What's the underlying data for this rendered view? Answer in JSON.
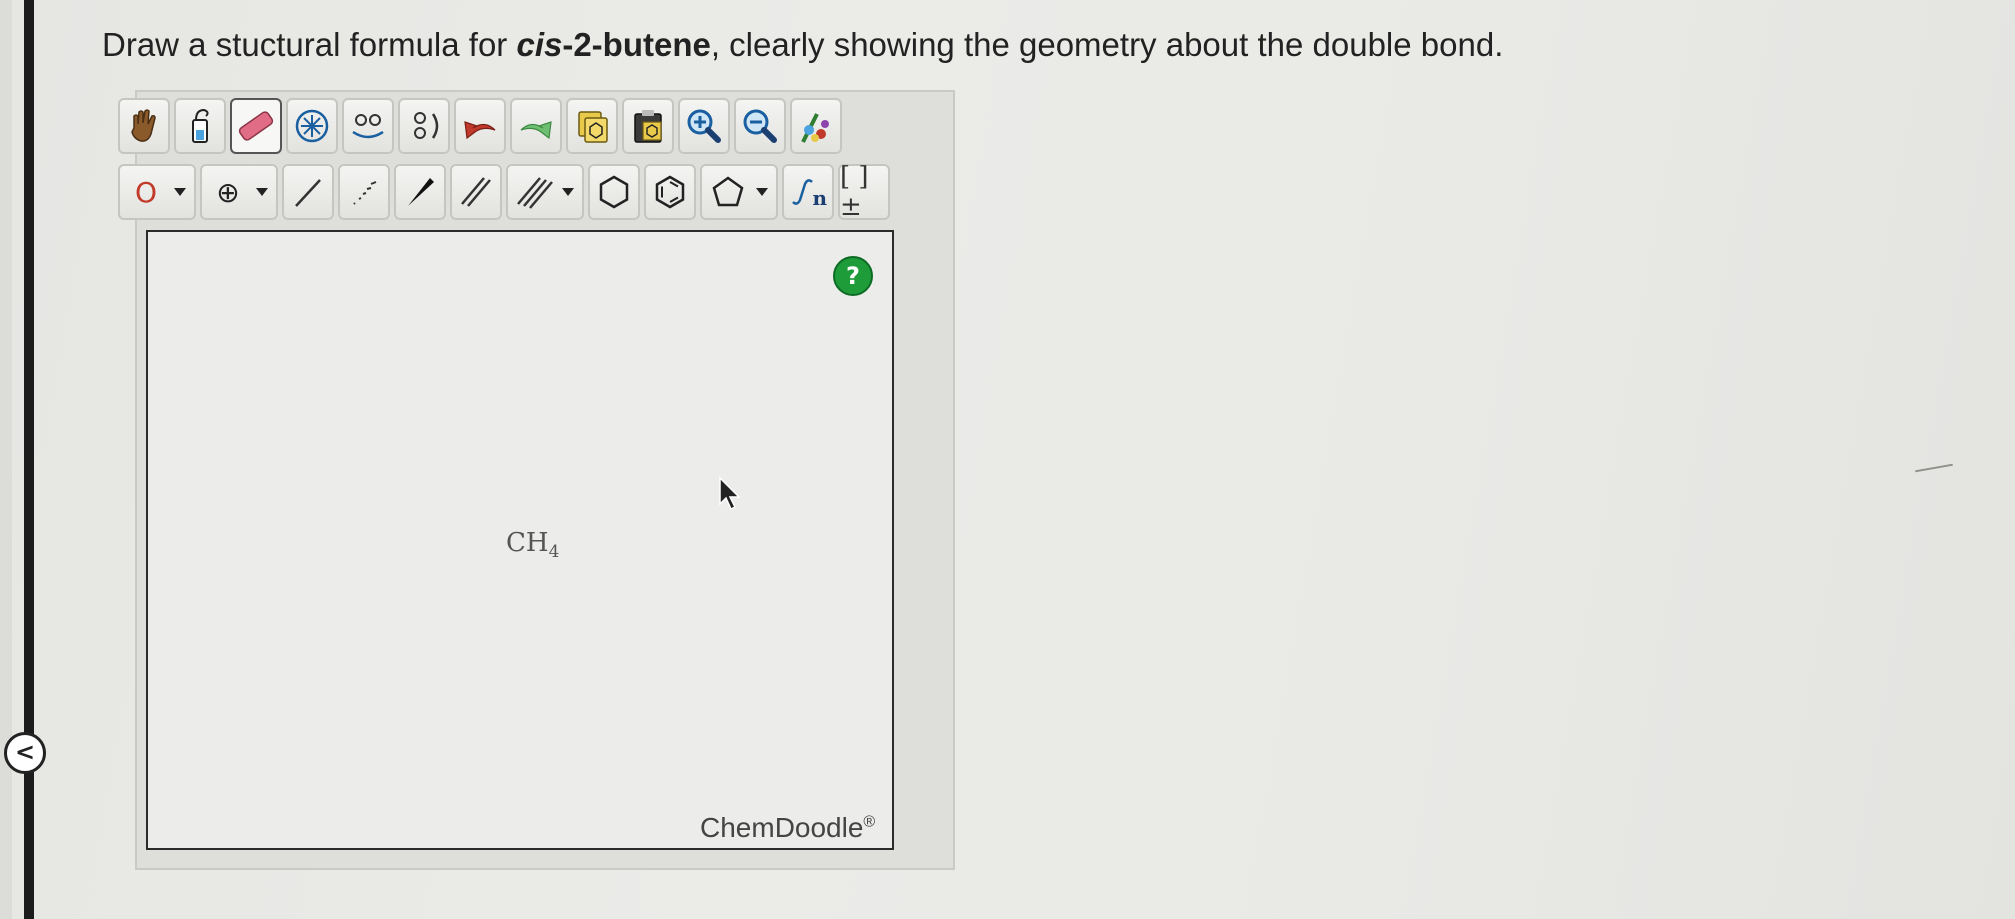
{
  "question": {
    "prefix": "Draw a stuctural formula for ",
    "molecule_italic": "cis",
    "molecule_rest": "-2-butene",
    "suffix": ", clearly showing the geometry about the double bond."
  },
  "toolbar_row1": [
    {
      "name": "hand-icon"
    },
    {
      "name": "lasso-icon"
    },
    {
      "name": "eraser-icon"
    },
    {
      "name": "center-icon"
    },
    {
      "name": "flip-icon"
    },
    {
      "name": "rotate-icon"
    },
    {
      "name": "undo-icon"
    },
    {
      "name": "redo-icon"
    },
    {
      "name": "copy-icon"
    },
    {
      "name": "paste-icon"
    },
    {
      "name": "zoom-in-icon"
    },
    {
      "name": "zoom-out-icon"
    },
    {
      "name": "clean-icon"
    }
  ],
  "toolbar_row2": {
    "atom_label": "O",
    "charge_label": "⊕",
    "bracket_label": "[ ]±",
    "repeat_label": "n"
  },
  "canvas": {
    "help_label": "?",
    "molecule": {
      "main": "CH",
      "sub": "4"
    },
    "watermark": "ChemDoodle",
    "watermark_mark": "®"
  },
  "back_label": "<",
  "colors": {
    "help_green": "#1f9c3a",
    "undo_red": "#c0392b",
    "redo_green": "#4caf50",
    "atom_red": "#c23a2a"
  }
}
